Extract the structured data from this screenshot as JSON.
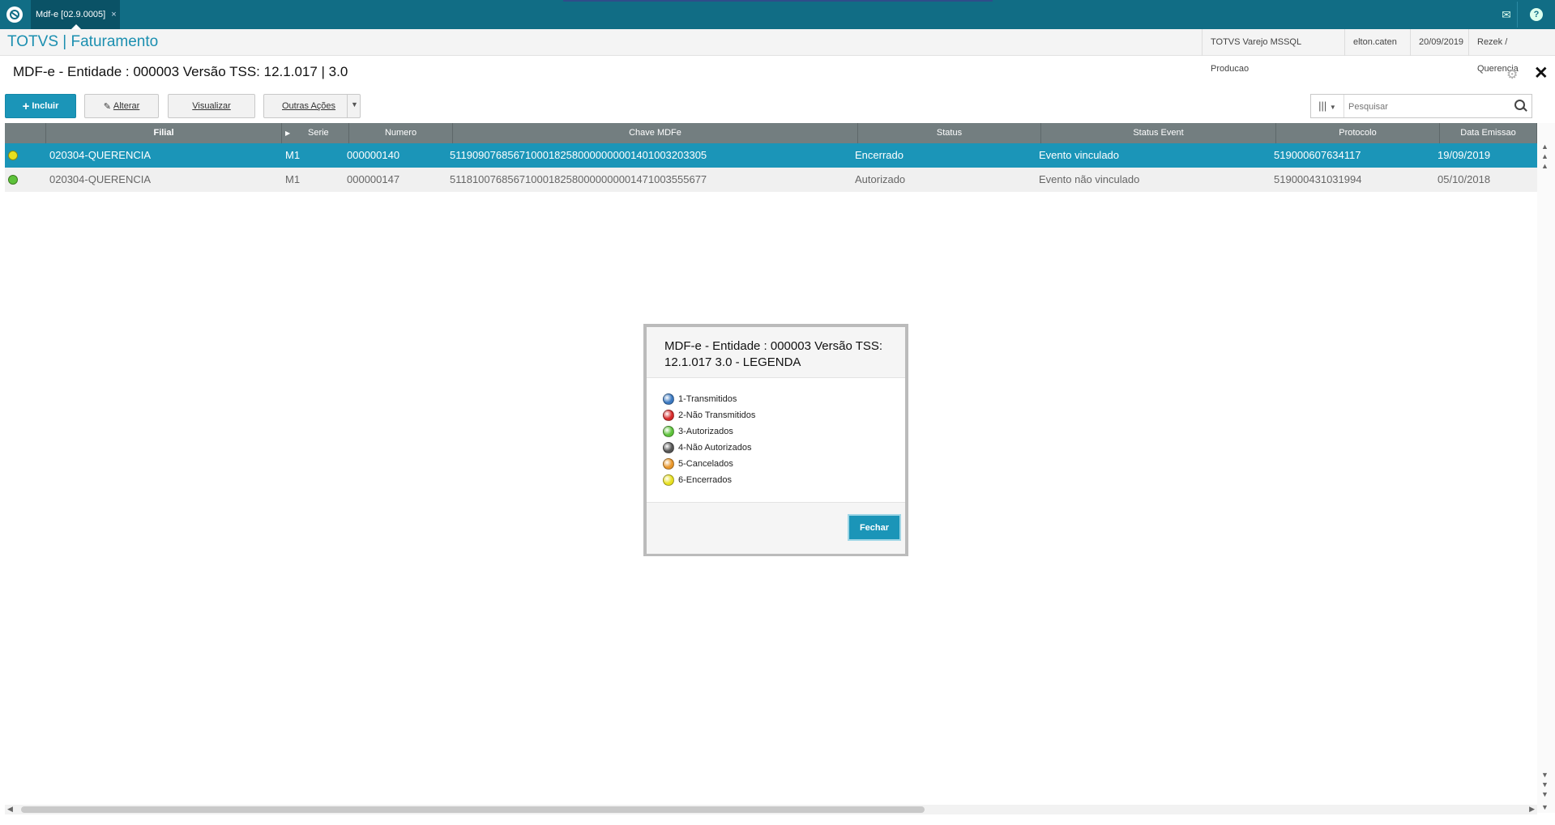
{
  "window": {
    "tab_title": "Mdf-e [02.9.0005]",
    "tab_close": "×"
  },
  "header": {
    "app_title": "TOTVS | Faturamento",
    "environment": "TOTVS Varejo MSSQL Producao",
    "user": "elton.caten",
    "date": "20/09/2019",
    "company": "Rezek / Querencia"
  },
  "page": {
    "title": "MDF-e - Entidade : 000003 Versão TSS: 12.1.017 | 3.0"
  },
  "toolbar": {
    "incluir_label": "Incluir",
    "alterar_label": "Alterar",
    "visualizar_label": "Visualizar",
    "outras_label": "Outras Ações",
    "search_placeholder": "Pesquisar"
  },
  "grid": {
    "columns": [
      "Filial",
      "Serie",
      "Numero",
      "Chave MDFe",
      "Status",
      "Status Event",
      "Protocolo",
      "Data Emissao"
    ],
    "rows": [
      {
        "status_color": "#e8e020",
        "filial": "020304-QUERENCIA",
        "serie": "M1",
        "numero": "000000140",
        "chave": "51190907685671000182580000000001401003203305",
        "status": "Encerrado",
        "status_event": "Evento vinculado",
        "protocolo": "519000607634117",
        "data_emissao": "19/09/2019"
      },
      {
        "status_color": "#5dc23a",
        "filial": "020304-QUERENCIA",
        "serie": "M1",
        "numero": "000000147",
        "chave": "51181007685671000182580000000001471003555677",
        "status": "Autorizado",
        "status_event": "Evento não vinculado",
        "protocolo": "519000431031994",
        "data_emissao": "05/10/2018"
      }
    ]
  },
  "legend_dialog": {
    "title": "MDF-e - Entidade : 000003 Versão TSS: 12.1.017  3.0 - LEGENDA",
    "items": [
      {
        "label": "1-Transmitidos",
        "color": "#3a78c0"
      },
      {
        "label": "2-Não Transmitidos",
        "color": "#d62a2a"
      },
      {
        "label": "3-Autorizados",
        "color": "#5dc23a"
      },
      {
        "label": "4-Não Autorizados",
        "color": "#555555"
      },
      {
        "label": "5-Cancelados",
        "color": "#e8962a"
      },
      {
        "label": "6-Encerrados",
        "color": "#e8e020"
      }
    ],
    "close_label": "Fechar"
  },
  "colors": {
    "topbar": "#116d85",
    "accent": "#1b95b8",
    "selected_row": "#1b95b8",
    "grid_header": "#737e80"
  }
}
